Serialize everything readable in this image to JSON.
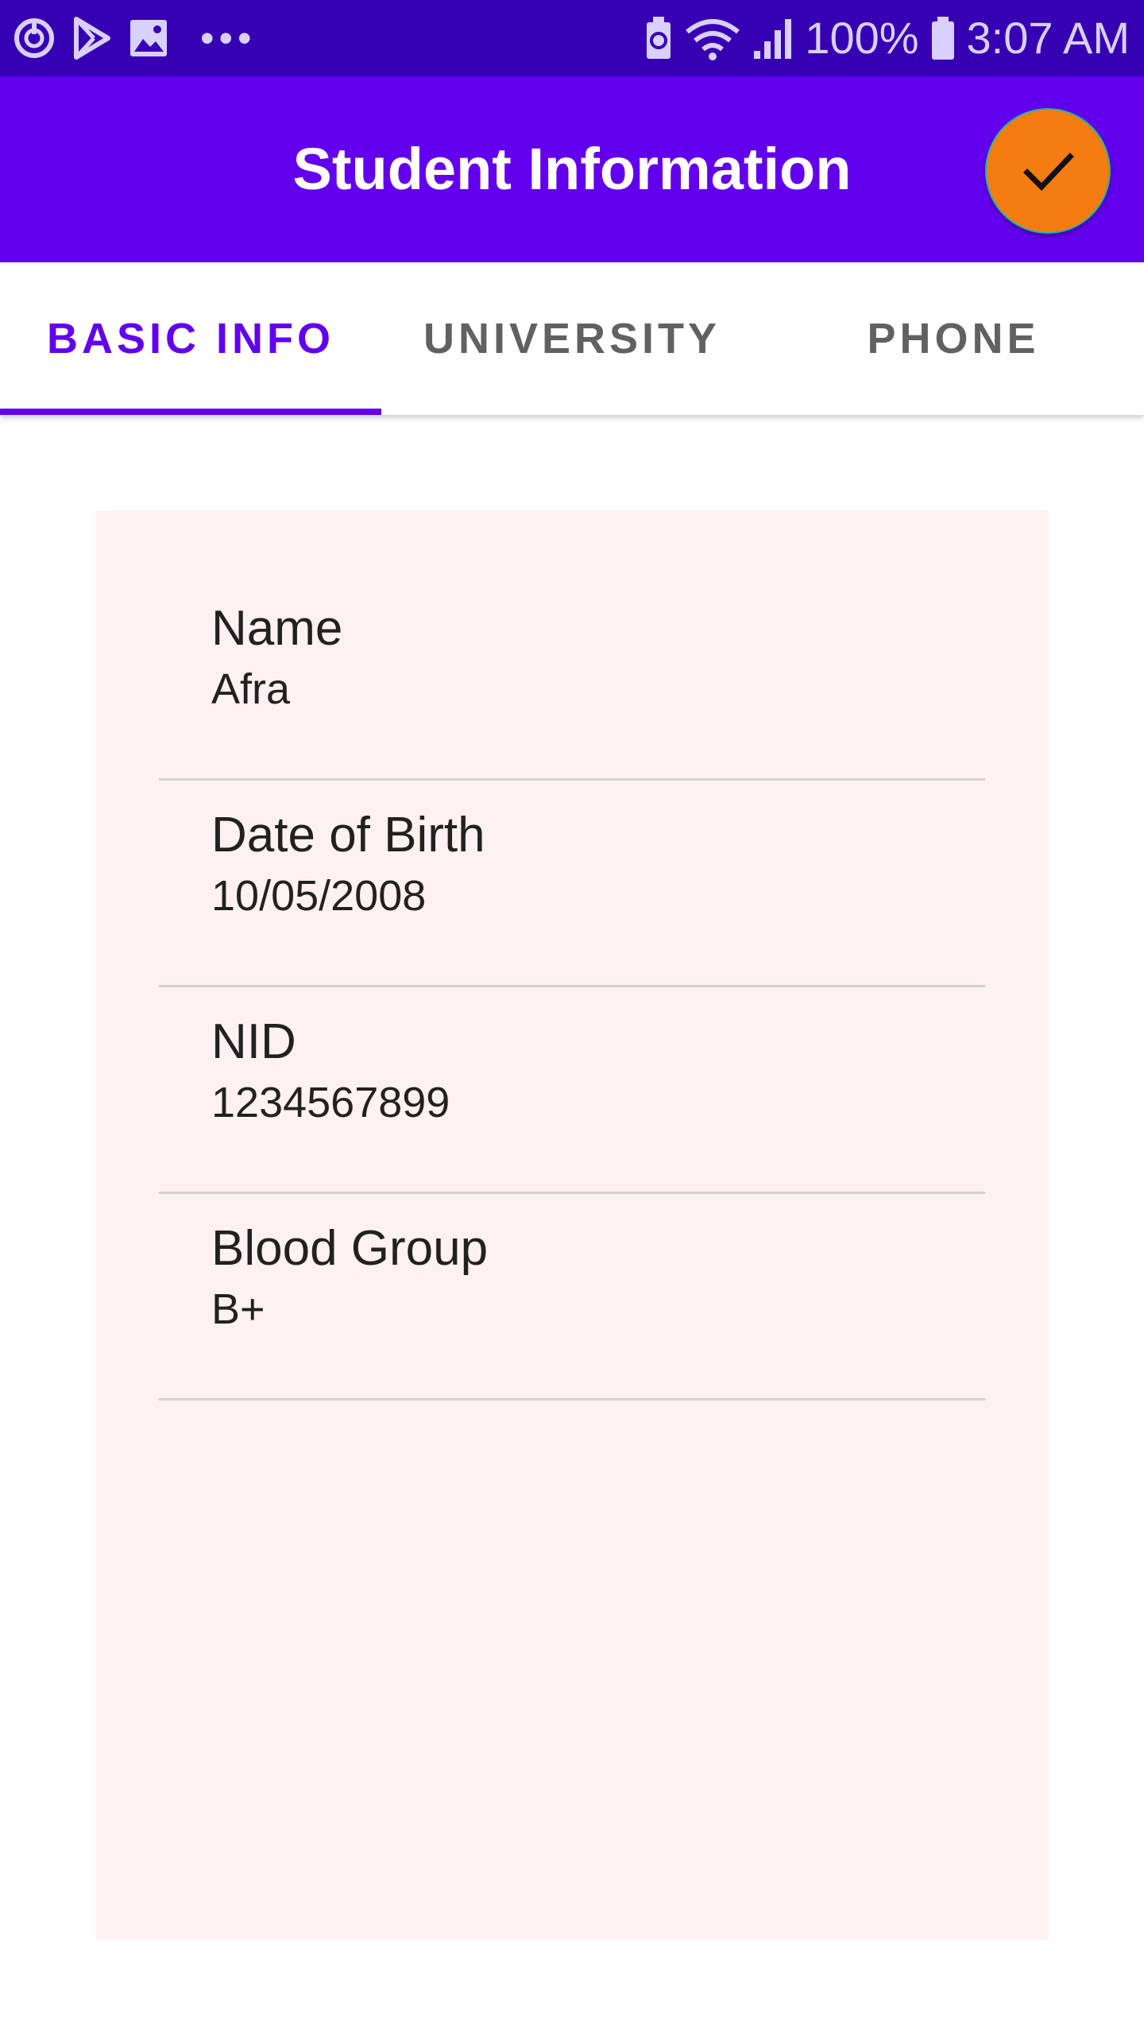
{
  "status_bar": {
    "battery": "100%",
    "time": "3:07 AM",
    "icons": [
      "sync-icon",
      "play-store-icon",
      "gallery-icon",
      "more-notifications-icon",
      "battery-saver-icon",
      "wifi-icon",
      "signal-icon",
      "battery-icon"
    ]
  },
  "app_bar": {
    "title": "Student Information",
    "action_icon": "check-icon",
    "color": "#6200ee",
    "fab_color": "#f57c10"
  },
  "tabs": [
    {
      "label": "BASIC INFO",
      "active": true
    },
    {
      "label": "UNIVERSITY",
      "active": false
    },
    {
      "label": "PHONE",
      "active": false
    }
  ],
  "card": {
    "background": "#fff1f1",
    "fields": [
      {
        "label": "Name",
        "value": "Afra"
      },
      {
        "label": "Date of Birth",
        "value": "10/05/2008"
      },
      {
        "label": "NID",
        "value": "1234567899"
      },
      {
        "label": "Blood Group",
        "value": "B+"
      }
    ]
  }
}
